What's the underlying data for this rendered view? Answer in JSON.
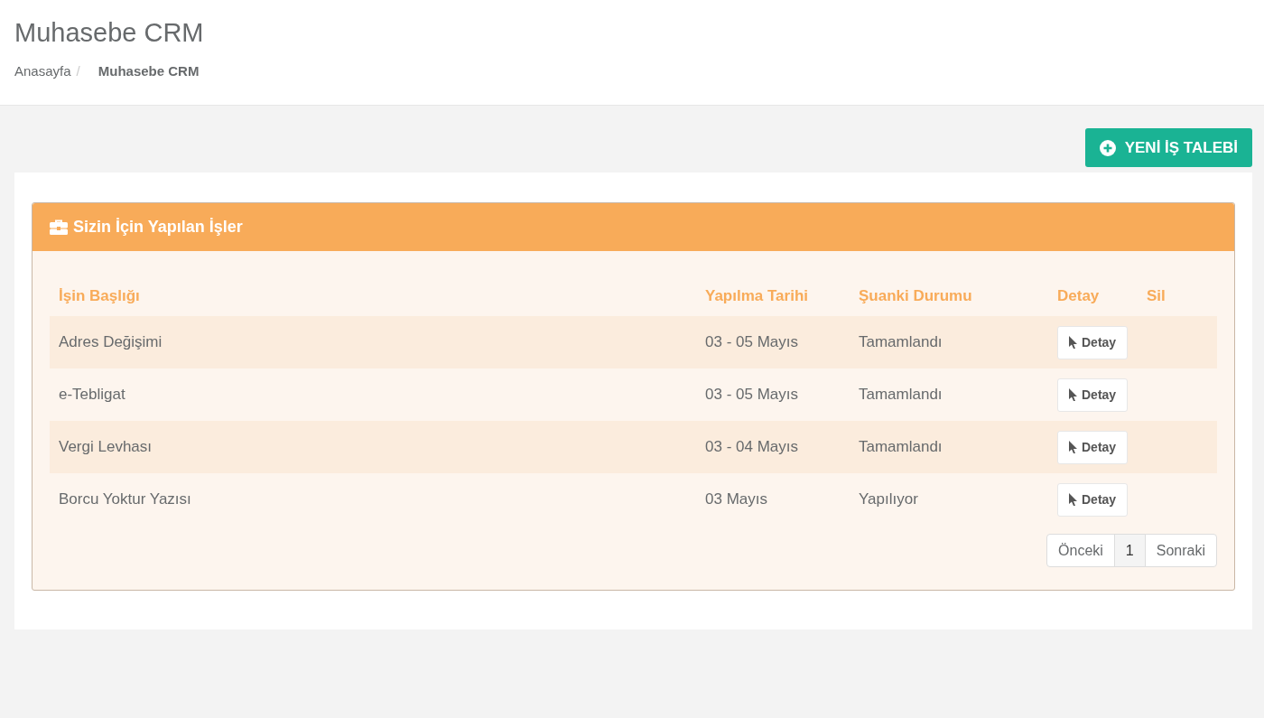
{
  "page_title": "Muhasebe CRM",
  "breadcrumb_separator": "/",
  "breadcrumb": [
    {
      "label": "Anasayfa",
      "current": false
    },
    {
      "label": "Muhasebe CRM",
      "current": true
    }
  ],
  "new_button": "YENİ İŞ TALEBİ",
  "panel": {
    "title": "Sizin İçin Yapılan İşler",
    "columns": [
      "İşin Başlığı",
      "Yapılma Tarihi",
      "Şuanki Durumu",
      "Detay",
      "Sil"
    ],
    "rows": [
      {
        "title": "Adres Değişimi",
        "date": "03 - 05 Mayıs",
        "status": "Tamamlandı",
        "action": "Detay"
      },
      {
        "title": "e-Tebligat",
        "date": "03 - 05 Mayıs",
        "status": "Tamamlandı",
        "action": "Detay"
      },
      {
        "title": "Vergi Levhası",
        "date": "03 - 04 Mayıs",
        "status": "Tamamlandı",
        "action": "Detay"
      },
      {
        "title": "Borcu Yoktur Yazısı",
        "date": "03 Mayıs",
        "status": "Yapılıyor",
        "action": "Detay"
      }
    ],
    "pagination": [
      {
        "label": "Önceki",
        "selected": false
      },
      {
        "label": "1",
        "selected": true
      },
      {
        "label": "Sonraki",
        "selected": false
      }
    ]
  }
}
